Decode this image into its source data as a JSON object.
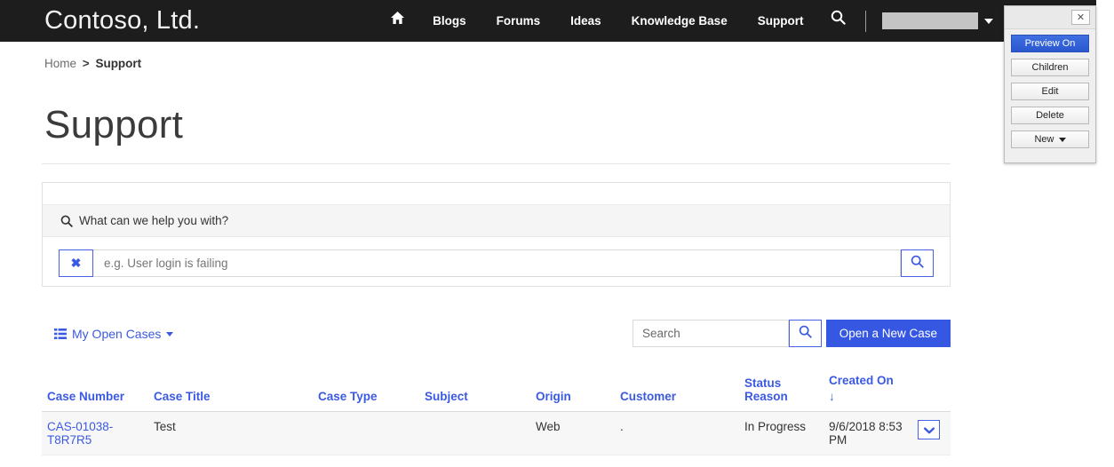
{
  "navbar": {
    "brand": "Contoso, Ltd.",
    "home_icon": "home-icon",
    "search_icon": "search-icon",
    "links": [
      {
        "label": "Blogs"
      },
      {
        "label": "Forums"
      },
      {
        "label": "Ideas"
      },
      {
        "label": "Knowledge Base"
      },
      {
        "label": "Support"
      }
    ],
    "user_account": {
      "label": "",
      "caret": "chevron-down-icon"
    },
    "background": "#1d1d1d"
  },
  "breadcrumb": {
    "home": "Home",
    "separator": ">",
    "current": "Support"
  },
  "page": {
    "title": "Support"
  },
  "kb_search": {
    "heading": "What can we help you with?",
    "heading_icon": "search-icon",
    "clear_label": "✖",
    "input_value": "",
    "input_placeholder": "e.g. User login is failing",
    "submit_icon": "search-icon",
    "accent": "#3b5ae0"
  },
  "cases_toolbar": {
    "view_label": "My Open Cases",
    "view_icon": "list-icon",
    "view_caret": "caret-down-icon",
    "search_value": "",
    "search_placeholder": "Search",
    "search_icon": "search-icon",
    "new_case_label": "Open a New Case",
    "button_color": "#3557e2"
  },
  "cases_table": {
    "columns": [
      {
        "label": "Case Number",
        "sorted": false
      },
      {
        "label": "Case Title",
        "sorted": false
      },
      {
        "label": "Case Type",
        "sorted": false
      },
      {
        "label": "Subject",
        "sorted": false
      },
      {
        "label": "Origin",
        "sorted": false
      },
      {
        "label": "Customer",
        "sorted": false
      },
      {
        "label": "Status Reason",
        "sorted": false
      },
      {
        "label": "Created On",
        "sorted": true,
        "sort_indicator": "↓"
      }
    ],
    "rows": [
      {
        "case_number": "CAS-01038-T8R7R5",
        "case_title": "Test",
        "case_type": "",
        "subject": "",
        "origin": "Web",
        "customer": ".",
        "status_reason": "In Progress",
        "created_on": "9/6/2018 8:53 PM",
        "row_menu_icon": "chevron-down-icon"
      }
    ]
  },
  "preview_panel": {
    "close_label": "✕",
    "buttons": [
      {
        "label": "Preview On",
        "active": true
      },
      {
        "label": "Children",
        "active": false
      },
      {
        "label": "Edit",
        "active": false
      },
      {
        "label": "Delete",
        "active": false
      },
      {
        "label": "New",
        "active": false,
        "has_caret": true
      }
    ],
    "active_color": "#2a57cf"
  }
}
